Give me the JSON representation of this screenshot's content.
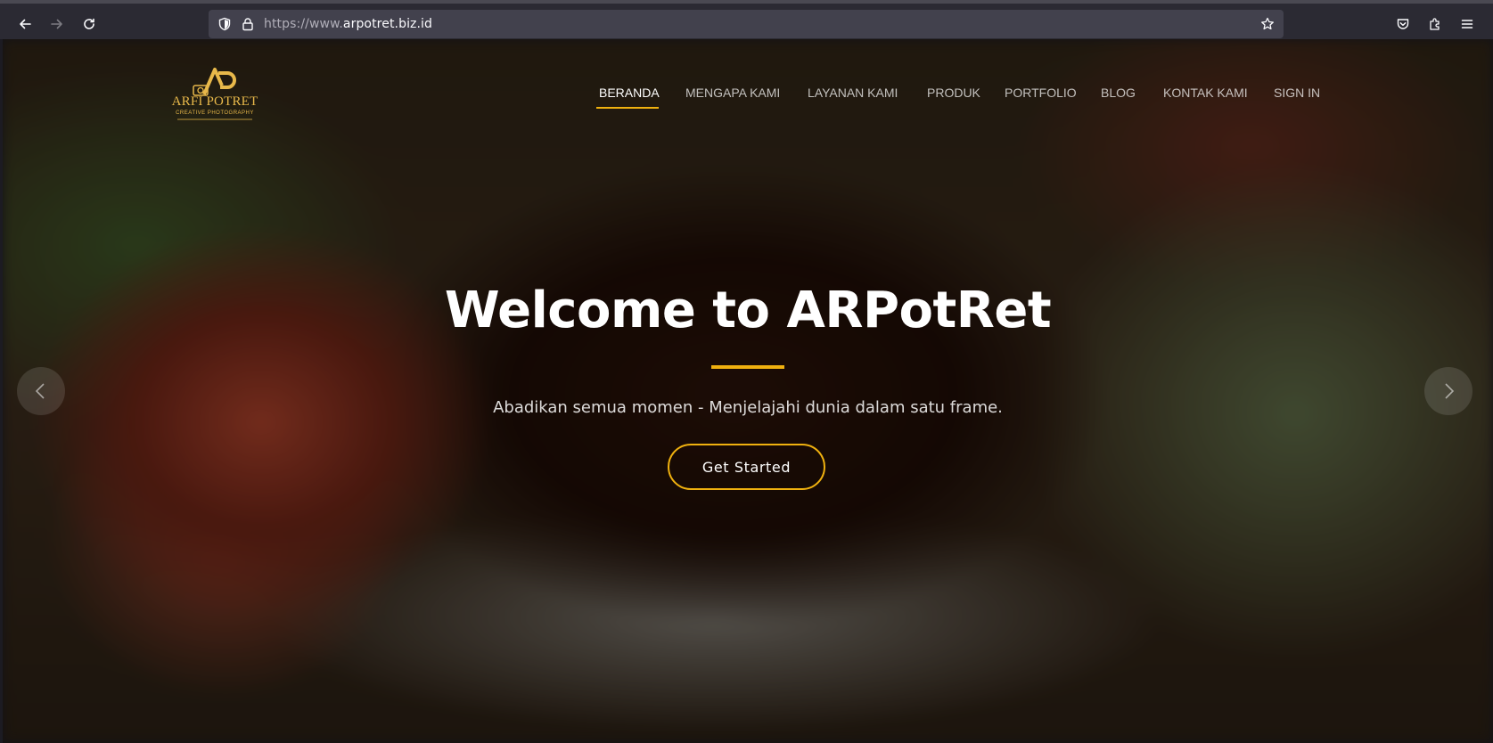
{
  "browser": {
    "url_prefix": "https://www.",
    "url_host": "arpotret.biz.id",
    "icons": {
      "back": "arrow-left-icon",
      "forward": "arrow-right-icon",
      "reload": "reload-icon",
      "shield": "shield-icon",
      "lock": "lock-icon",
      "bookmark": "star-icon",
      "pocket": "pocket-icon",
      "extensions": "puzzle-icon",
      "menu": "hamburger-icon"
    }
  },
  "site": {
    "logo": {
      "brand": "ARFI POTRET",
      "tagline": "CREATIVE PHOTOGRAPHY"
    },
    "nav": [
      {
        "label": "BERANDA",
        "active": true
      },
      {
        "label": "MENGAPA KAMI",
        "active": false
      },
      {
        "label": "LAYANAN KAMI",
        "active": false
      },
      {
        "label": "PRODUK",
        "active": false
      },
      {
        "label": "PORTFOLIO",
        "active": false
      },
      {
        "label": "BLOG",
        "active": false
      },
      {
        "label": "KONTAK KAMI",
        "active": false
      },
      {
        "label": "SIGN IN",
        "active": false
      }
    ],
    "hero": {
      "title": "Welcome to ARPotRet",
      "subtitle": "Abadikan semua momen - Menjelajahi dunia dalam satu frame.",
      "cta_label": "Get Started"
    },
    "colors": {
      "accent": "#f0b10f",
      "logo_gold": "#e8b84a"
    }
  }
}
